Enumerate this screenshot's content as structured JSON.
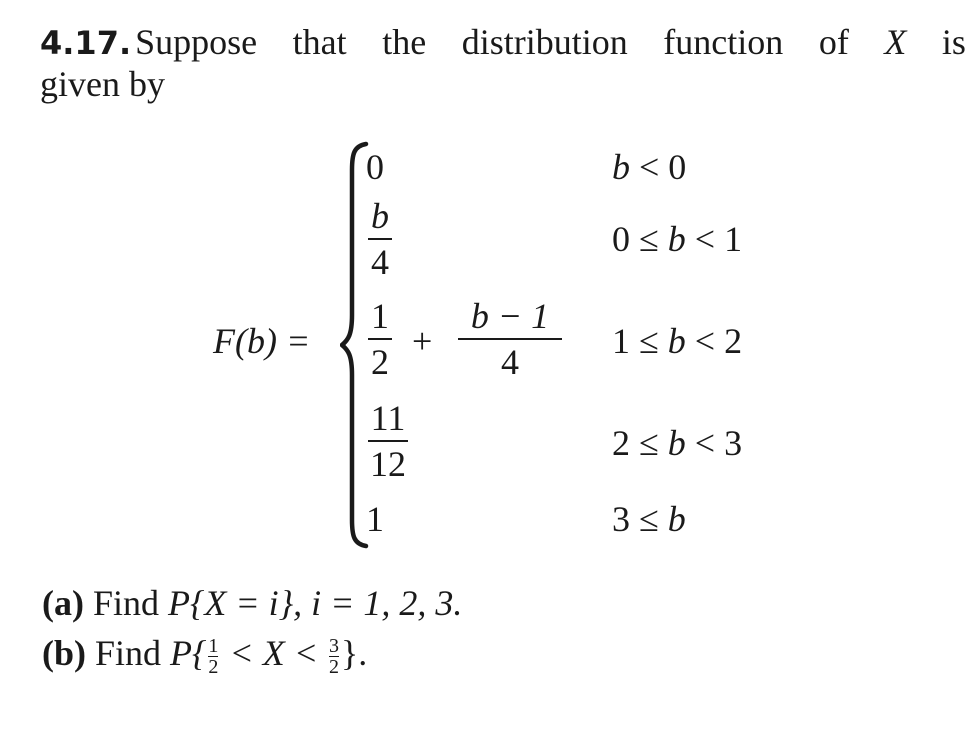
{
  "problem": {
    "number": "4.17.",
    "intro_words": [
      "Suppose",
      "that",
      "the",
      "distribution",
      "function",
      "of",
      "X",
      "is"
    ],
    "intro_line2": "given by"
  },
  "equation": {
    "lhs": "F(b) =",
    "cases": [
      {
        "value": "0",
        "condition": "b < 0"
      },
      {
        "value_num": "b",
        "value_den": "4",
        "condition": "0 ≤ b < 1"
      },
      {
        "value_a_num": "1",
        "value_a_den": "2",
        "plus": "+",
        "value_b_num": "b − 1",
        "value_b_den": "4",
        "condition": "1 ≤ b < 2"
      },
      {
        "value_num": "11",
        "value_den": "12",
        "condition": "2 ≤ b < 3"
      },
      {
        "value": "1",
        "condition": "3 ≤ b"
      }
    ]
  },
  "questions": {
    "a": {
      "label": "(a)",
      "text_prefix": "Find ",
      "text_math": "P{X = i}, i = 1, 2, 3."
    },
    "b": {
      "label": "(b)",
      "text_prefix": "Find ",
      "math_p": "P{",
      "frac1_num": "1",
      "frac1_den": "2",
      "middle": " < X < ",
      "frac2_num": "3",
      "frac2_den": "2",
      "math_end": "}."
    }
  }
}
